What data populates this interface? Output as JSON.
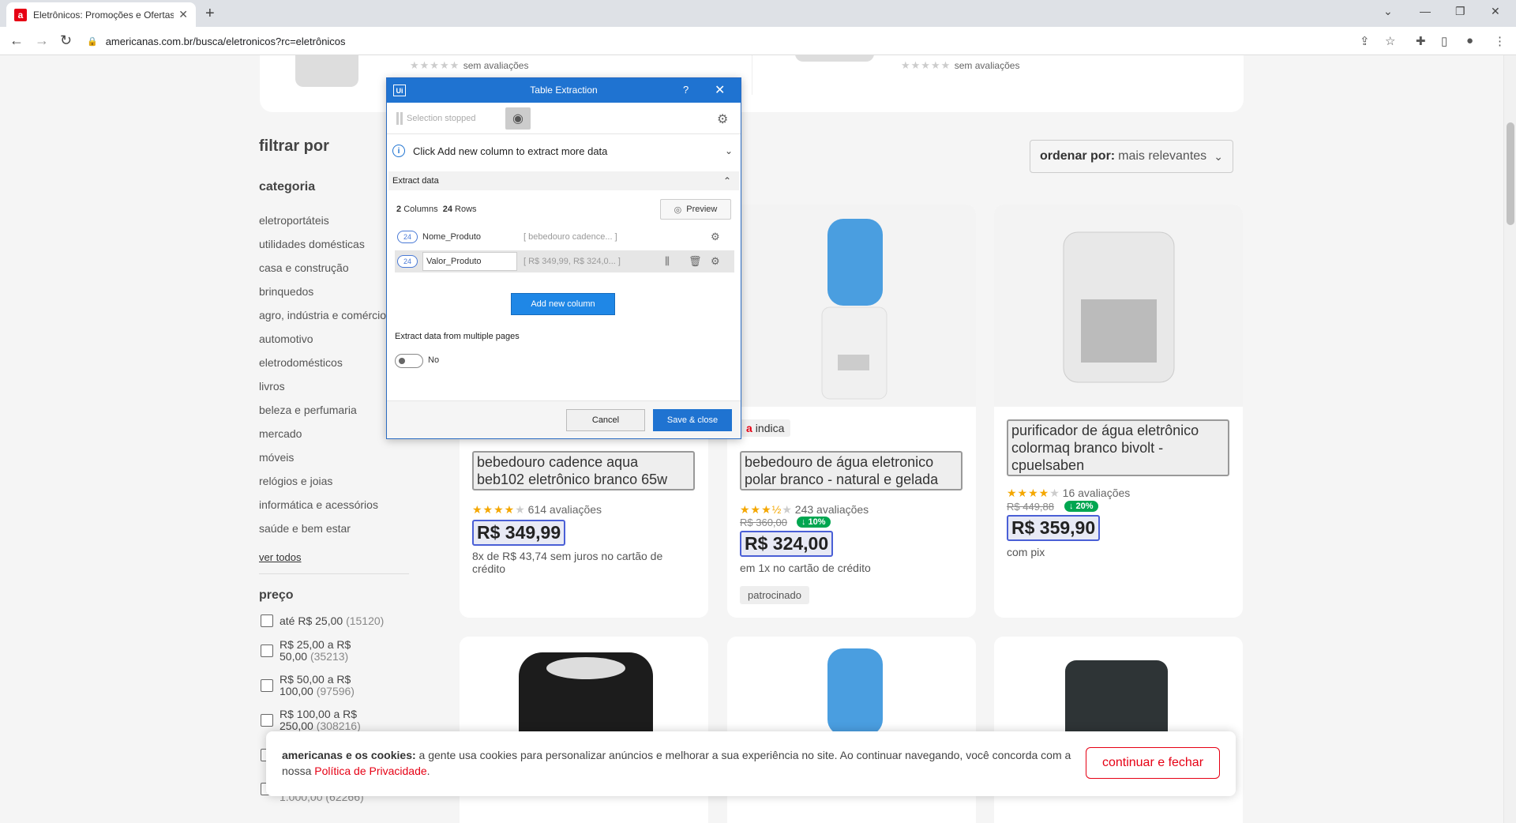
{
  "browser": {
    "tab_title": "Eletrônicos: Promoções e Ofertas",
    "url": "americanas.com.br/busca/eletronicos?rc=eletrônicos"
  },
  "top_cards": {
    "left_reviews": "sem avaliações",
    "right_reviews": "sem avaliações"
  },
  "sidebar": {
    "filter_title": "filtrar por",
    "category_title": "categoria",
    "categories": [
      "eletroportáteis",
      "utilidades domésticas",
      "casa e construção",
      "brinquedos",
      "agro, indústria e comércio",
      "automotivo",
      "eletrodomésticos",
      "livros",
      "beleza e perfumaria",
      "mercado",
      "móveis",
      "relógios e joias",
      "informática e acessórios",
      "saúde e bem estar"
    ],
    "see_all": "ver todos",
    "price_title": "preço",
    "prices": [
      {
        "label": "até R$ 25,00",
        "count": "(15120)"
      },
      {
        "label": "R$ 25,00 a R$",
        "label2": "50,00",
        "count": "(35213)"
      },
      {
        "label": "R$ 50,00 a R$",
        "label2": "100,00",
        "count": "(97596)"
      },
      {
        "label": "R$ 100,00 a R$",
        "label2": "250,00",
        "count": "(308216)"
      }
    ],
    "price_partial": "1.000,00",
    "price_partial_count": "(62266)"
  },
  "sort": {
    "label": "ordenar por:",
    "value": "mais relevantes"
  },
  "products": [
    {
      "name_line1": "bebedouro cadence aqua",
      "name_line2": "beb102 eletrônico branco 65w",
      "reviews": "614 avaliações",
      "price": "R$ 349,99",
      "installment_line1": "8x de R$ 43,74 sem juros no cartão de",
      "installment_line2": "crédito"
    },
    {
      "tag": "indica",
      "name_line1": "bebedouro de água eletronico",
      "name_line2": "polar branco - natural e gelada",
      "reviews": "243 avaliações",
      "old_price": "R$ 360,00",
      "discount": "↓ 10%",
      "price": "R$ 324,00",
      "installment_line1": "em 1x no cartão de crédito",
      "sponsored": "patrocinado"
    },
    {
      "name_line1": "purificador de água eletrônico",
      "name_line2": "colormaq branco bivolt -",
      "name_line3": "cpuelsaben",
      "reviews": "16 avaliações",
      "old_price": "R$ 449,88",
      "discount": "↓ 20%",
      "price": "R$ 359,90",
      "installment_line1": "com pix"
    }
  ],
  "cookie": {
    "bold": "americanas e os cookies:",
    "text": " a gente usa cookies para personalizar anúncios e melhorar a sua experiência no site. Ao continuar navegando, você concorda com a nossa ",
    "link": "Política de Privacidade",
    "end": ".",
    "button": "continuar e fechar"
  },
  "dialog": {
    "logo": "Ui",
    "title": "Table Extraction",
    "help": "?",
    "selection_status": "Selection stopped",
    "info": "Click Add new column to extract more data",
    "section": "Extract data",
    "columns_count": "2",
    "columns_label": "Columns",
    "rows_count": "24",
    "rows_label": "Rows",
    "preview": "Preview",
    "columns": [
      {
        "count": "24",
        "name": "Nome_Produto",
        "sample": "[ bebedouro cadence... ]"
      },
      {
        "count": "24",
        "name": "Valor_Produto",
        "sample": "[ R$ 349,99, R$ 324,0... ]"
      }
    ],
    "add_column": "Add new column",
    "multi_pages": "Extract data from multiple pages",
    "toggle_value": "No",
    "cancel": "Cancel",
    "save": "Save & close"
  }
}
